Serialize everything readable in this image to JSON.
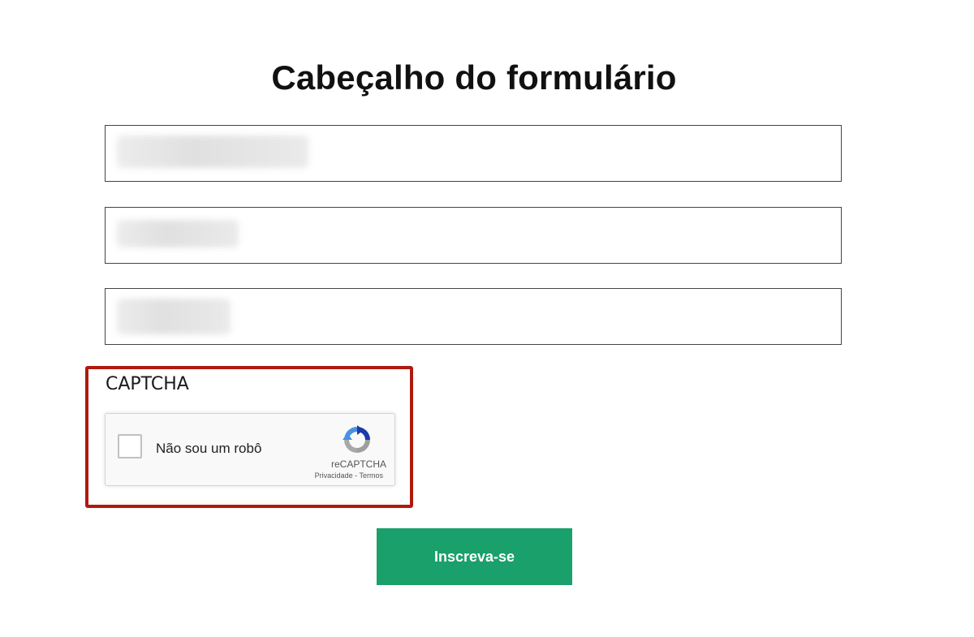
{
  "form": {
    "title": "Cabeçalho do formulário",
    "fields": [
      {
        "name": "field-1",
        "value": "",
        "redacted": true
      },
      {
        "name": "field-2",
        "value": "",
        "redacted": true
      },
      {
        "name": "field-3",
        "value": "",
        "redacted": true
      }
    ],
    "captcha": {
      "label": "CAPTCHA",
      "checkbox_text": "Não sou um robô",
      "brand": "reCAPTCHA",
      "privacy_link": "Privacidade",
      "separator": " - ",
      "terms_link": "Termos",
      "highlight_color": "#b0190e"
    },
    "submit_label": "Inscreva-se",
    "submit_color": "#1aa06a"
  },
  "icons": {
    "recaptcha_logo": "recaptcha-logo-icon"
  }
}
